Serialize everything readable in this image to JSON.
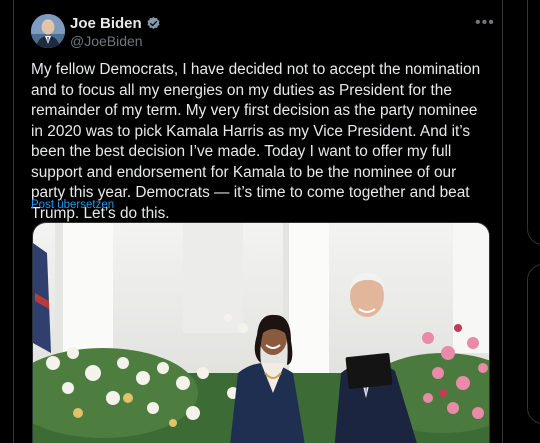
{
  "tweet": {
    "author": {
      "display_name": "Joe Biden",
      "handle": "@JoeBiden",
      "verified": true
    },
    "text": "My fellow Democrats, I have decided not to accept the nomination and to focus all my energies on my duties as President for the remainder of my term. My very first decision as the party nominee in 2020 was to pick Kamala Harris as my Vice President. And it’s been the best decision I’ve made. Today I want to offer my full support and endorsement for Kamala to be the nominee of our party this year. Democrats — it’s time to come together and beat Trump. Let’s do this.",
    "translate_label": "Post übersetzen",
    "more_label": "•••"
  },
  "colors": {
    "background": "#000000",
    "text": "#e7e9ea",
    "secondary": "#71767b",
    "accent": "#1d9bf0",
    "border": "#2f3336"
  },
  "icons": {
    "verified": "verified-badge-icon",
    "more": "more-options-icon"
  }
}
